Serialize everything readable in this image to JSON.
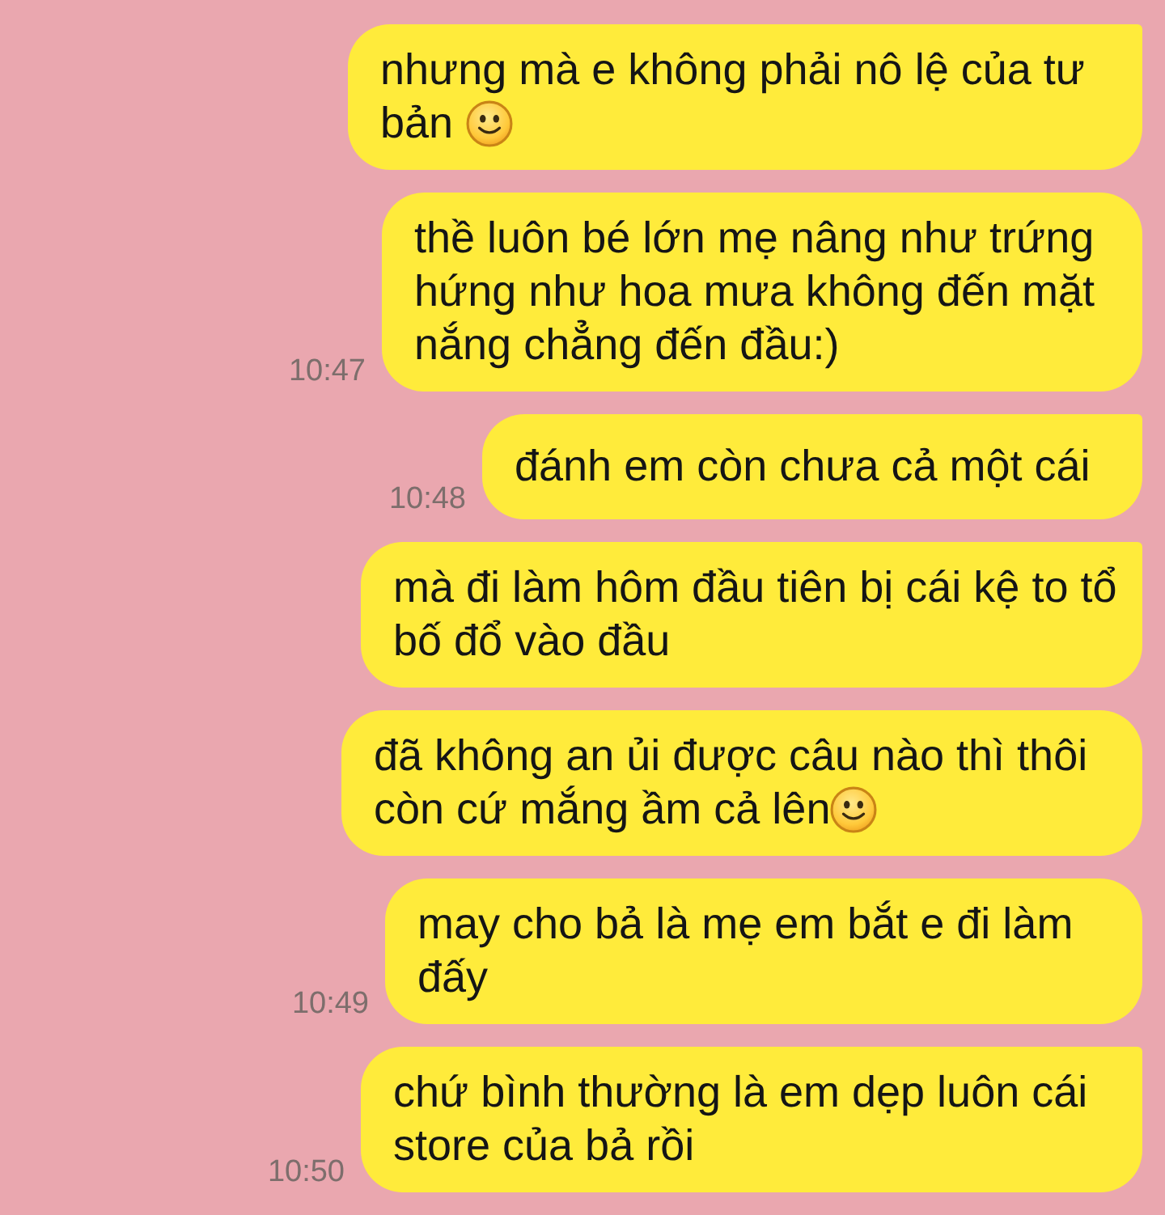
{
  "messages": [
    {
      "text": "nhưng mà e không phải nô lệ của tư bản",
      "emoji": true,
      "tail": true
    },
    {
      "text": "thề luôn bé lớn mẹ nâng như trứng hứng như hoa mưa không đến mặt nắng chẳng đến đầu:)",
      "time": "10:47",
      "emoji": false,
      "tail": false
    },
    {
      "text": "đánh em còn chưa cả một cái",
      "time": "10:48",
      "emoji": false,
      "tail": true
    },
    {
      "text": "mà đi làm hôm đầu tiên bị cái kệ to tổ bố đổ vào đầu",
      "emoji": false,
      "tail": true
    },
    {
      "text": "đã không an ủi được câu nào thì thôi còn cứ mắng ầm cả lên",
      "emoji": true,
      "tail": false
    },
    {
      "text": "may cho bả là mẹ em bắt e đi làm đấy",
      "time": "10:49",
      "emoji": false,
      "tail": false
    },
    {
      "text": "chứ bình thường là em dẹp luôn cái store của bả rồi",
      "time": "10:50",
      "emoji": false,
      "tail": true
    }
  ]
}
